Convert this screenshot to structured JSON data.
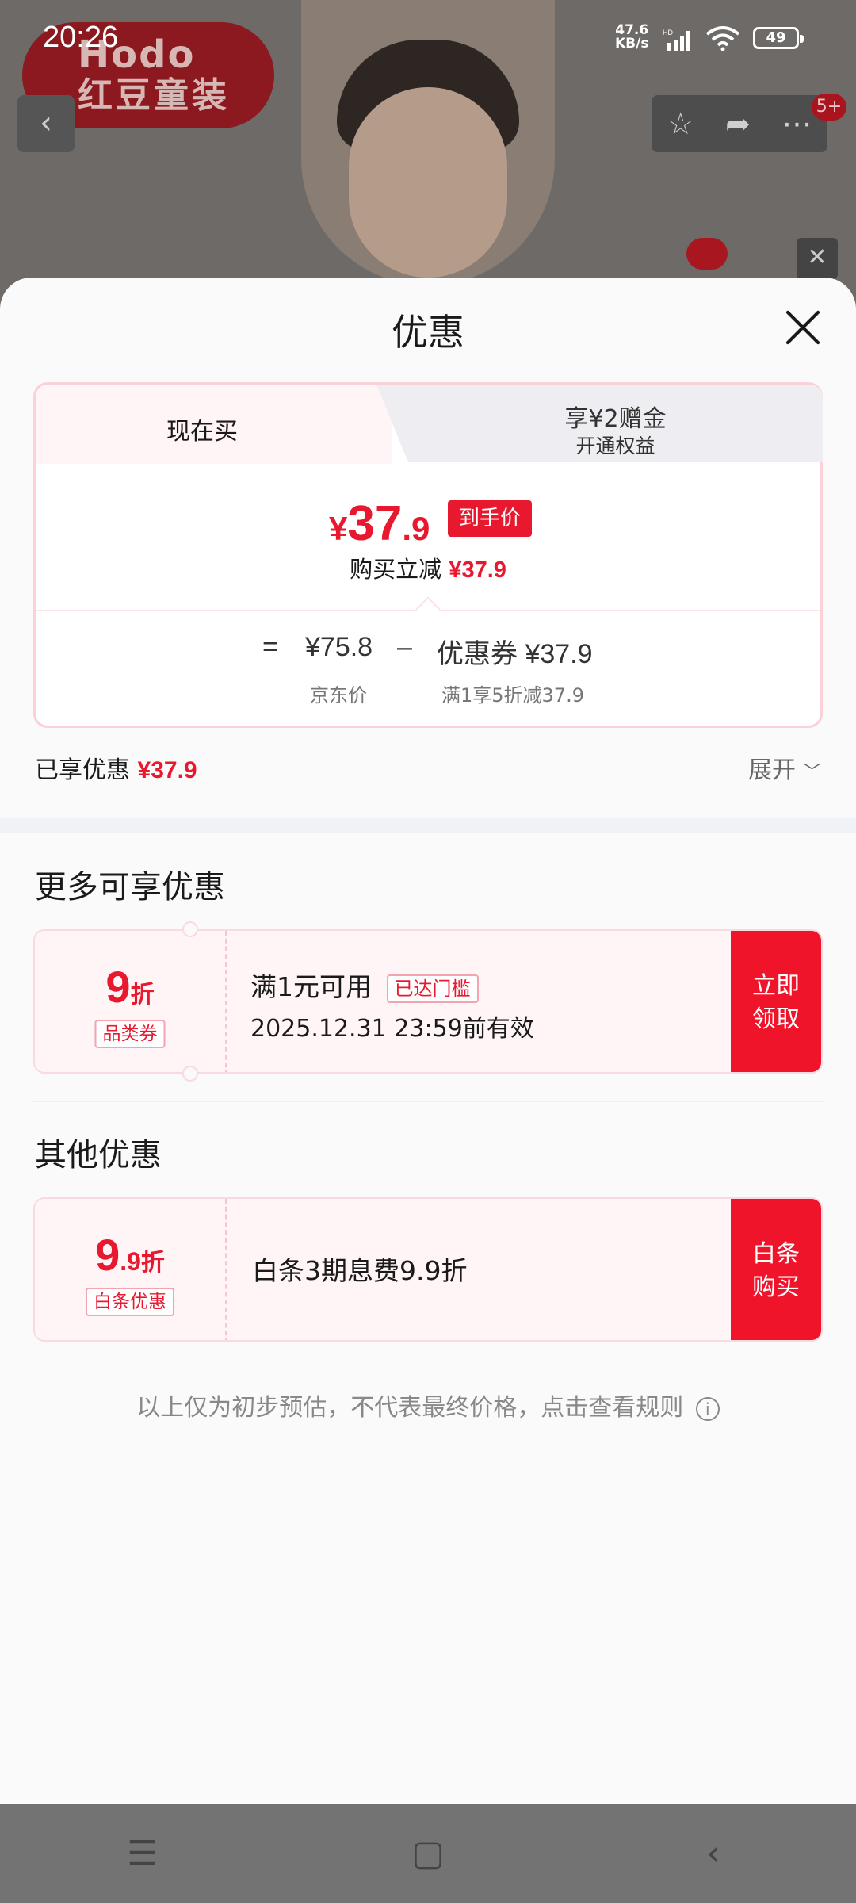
{
  "status_bar": {
    "time": "20:26",
    "net_speed_top": "47.6",
    "net_speed_unit": "KB/s",
    "hd": "HD",
    "battery": "49"
  },
  "header": {
    "brand_top": "Hodo",
    "brand_bottom": "红豆童装",
    "cart_badge": "5+"
  },
  "sheet": {
    "title": "优惠",
    "tabs": [
      {
        "label": "现在买"
      },
      {
        "label": "享¥2赠金",
        "sub": "开通权益"
      }
    ],
    "final_price": {
      "symbol": "¥",
      "integer": "37",
      "decimal": ".9",
      "tag": "到手价"
    },
    "reduce": {
      "label": "购买立减",
      "amount": "¥37.9"
    },
    "formula": {
      "equals": "=",
      "jd_price": "¥75.8",
      "minus": "–",
      "coupon": "优惠券 ¥37.9",
      "jd_price_label": "京东价",
      "coupon_desc": "满1享5折减37.9"
    },
    "enjoyed": {
      "label": "已享优惠",
      "amount": "¥37.9"
    },
    "expand_label": "展开"
  },
  "more_offers": {
    "title": "更多可享优惠",
    "coupon": {
      "discount_num": "9",
      "discount_unit": "折",
      "type_tag": "品类券",
      "condition": "满1元可用",
      "threshold_tag": "已达门槛",
      "validity": "2025.12.31 23:59前有效",
      "action_line1": "立即",
      "action_line2": "领取"
    }
  },
  "other_offers": {
    "title": "其他优惠",
    "coupon": {
      "discount_num": "9",
      "discount_decimal": ".9",
      "discount_unit": "折",
      "type_tag": "白条优惠",
      "desc": "白条3期息费9.9折",
      "action_line1": "白条",
      "action_line2": "购买"
    }
  },
  "disclaimer": "以上仅为初步预估，不代表最终价格，点击查看规则",
  "colors": {
    "accent": "#e8182f",
    "accent_bg": "#fff5f6",
    "border": "#fbd0d6"
  }
}
